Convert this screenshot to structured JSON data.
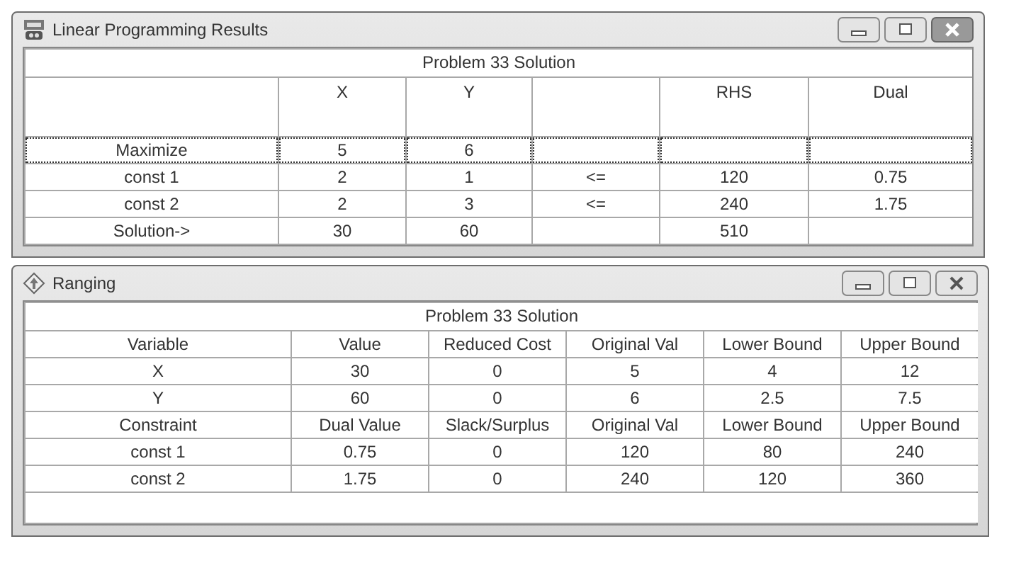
{
  "windows": [
    {
      "title": "Linear Programming Results",
      "kind": "results",
      "grid_title": "Problem 33 Solution",
      "columns": [
        "",
        "X",
        "Y",
        "",
        "RHS",
        "Dual"
      ],
      "rows": [
        {
          "cells": [
            "Maximize",
            "5",
            "6",
            "",
            "",
            ""
          ],
          "selected": true
        },
        {
          "cells": [
            "const 1",
            "2",
            "1",
            "<=",
            "120",
            "0.75"
          ],
          "selected": false
        },
        {
          "cells": [
            "const 2",
            "2",
            "3",
            "<=",
            "240",
            "1.75"
          ],
          "selected": false
        },
        {
          "cells": [
            "Solution->",
            "30",
            "60",
            "",
            "510",
            ""
          ],
          "selected": false
        }
      ]
    },
    {
      "title": "Ranging",
      "kind": "ranging",
      "grid_title": "Problem 33 Solution",
      "rows": [
        {
          "cells": [
            "Variable",
            "Value",
            "Reduced Cost",
            "Original Val",
            "Lower Bound",
            "Upper Bound"
          ],
          "selected": false
        },
        {
          "cells": [
            "X",
            "30",
            "0",
            "5",
            "4",
            "12"
          ],
          "selected": false
        },
        {
          "cells": [
            "Y",
            "60",
            "0",
            "6",
            "2.5",
            "7.5"
          ],
          "selected": false
        },
        {
          "cells": [
            "Constraint",
            "Dual Value",
            "Slack/Surplus",
            "Original Val",
            "Lower Bound",
            "Upper Bound"
          ],
          "selected": false
        },
        {
          "cells": [
            "const 1",
            "0.75",
            "0",
            "120",
            "80",
            "240"
          ],
          "selected": false
        },
        {
          "cells": [
            "const 2",
            "1.75",
            "0",
            "240",
            "120",
            "360"
          ],
          "selected": false
        }
      ]
    }
  ]
}
